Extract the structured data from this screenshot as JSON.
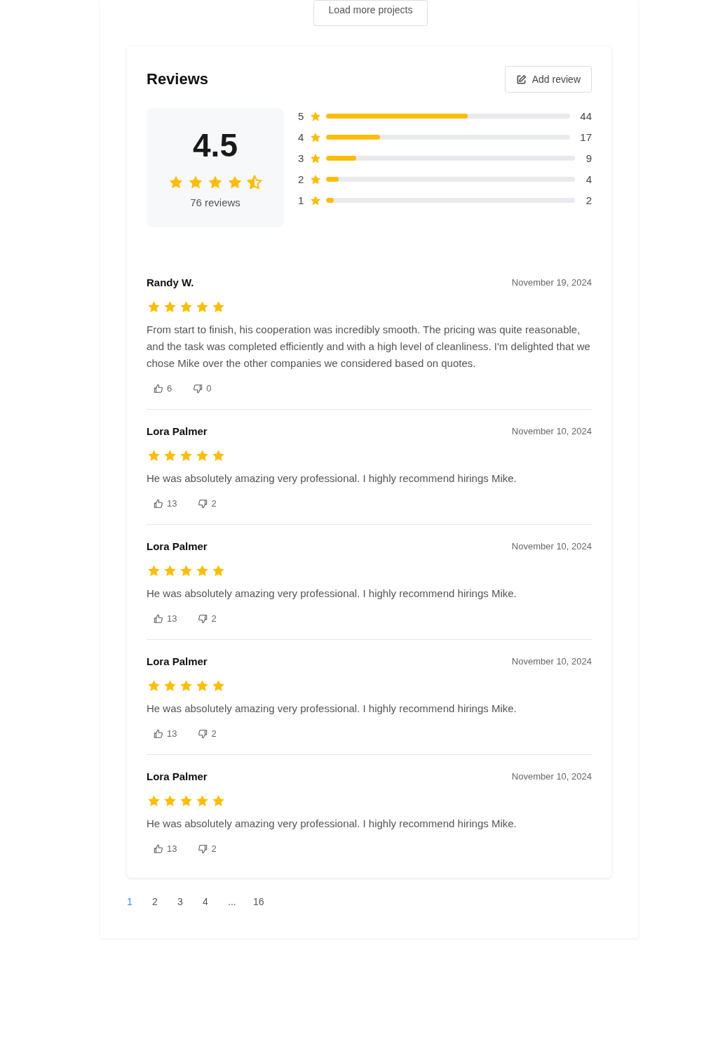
{
  "load_more": {
    "label": "Load more projects"
  },
  "reviews": {
    "title": "Reviews",
    "add_button": "Add review",
    "summary": {
      "score": "4.5",
      "stars": 4.5,
      "count": "76 reviews"
    },
    "breakdown": [
      {
        "rating": "5",
        "level": 0.58,
        "count": "44"
      },
      {
        "rating": "4",
        "level": 0.22,
        "count": "17"
      },
      {
        "rating": "3",
        "level": 0.12,
        "count": "9"
      },
      {
        "rating": "2",
        "level": 0.05,
        "count": "4"
      },
      {
        "rating": "1",
        "level": 0.03,
        "count": "2"
      }
    ],
    "items": [
      {
        "author": "Randy W.",
        "date": "November 19, 2024",
        "stars": 5,
        "text": "From start to finish, his cooperation was incredibly smooth. The pricing was quite reasonable, and the task was completed efficiently and with a high level of cleanliness. I'm delighted that we chose Mike over the other companies we considered based on quotes.",
        "likes": "6",
        "dislikes": "0"
      },
      {
        "author": "Lora Palmer",
        "date": "November 10, 2024",
        "stars": 5,
        "text": "He was absolutely amazing very professional. I highly recommend hirings Mike.",
        "likes": "13",
        "dislikes": "2"
      },
      {
        "author": "Lora Palmer",
        "date": "November 10, 2024",
        "stars": 5,
        "text": "He was absolutely amazing very professional. I highly recommend hirings Mike.",
        "likes": "13",
        "dislikes": "2"
      },
      {
        "author": "Lora Palmer",
        "date": "November 10, 2024",
        "stars": 5,
        "text": "He was absolutely amazing very professional. I highly recommend hirings Mike.",
        "likes": "13",
        "dislikes": "2"
      },
      {
        "author": "Lora Palmer",
        "date": "November 10, 2024",
        "stars": 5,
        "text": "He was absolutely amazing very professional. I highly recommend hirings Mike.",
        "likes": "13",
        "dislikes": "2"
      }
    ]
  },
  "pagination": [
    {
      "label": "1",
      "selected": true
    },
    {
      "label": "2",
      "selected": false
    },
    {
      "label": "3",
      "selected": false
    },
    {
      "label": "4",
      "selected": false
    },
    {
      "label": "...",
      "selected": false
    },
    {
      "label": "16",
      "selected": false
    }
  ]
}
